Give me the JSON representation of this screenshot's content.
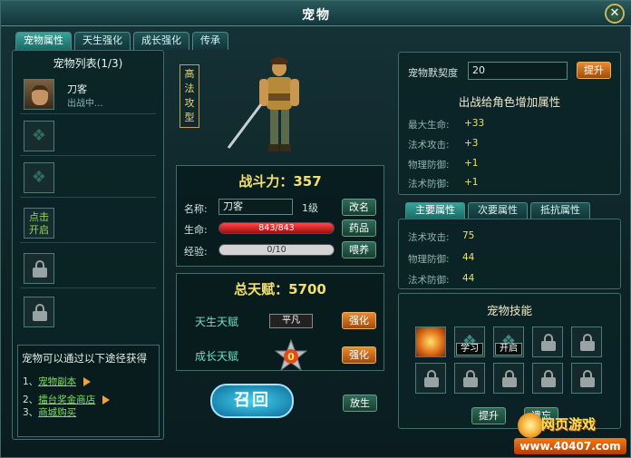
{
  "window": {
    "title": "宠物",
    "close_icon": "✕"
  },
  "tabs": [
    "宠物属性",
    "天生强化",
    "成长强化",
    "传承"
  ],
  "pet_list": {
    "title": "宠物列表(1/3)",
    "pets": [
      {
        "name": "刀客",
        "status": "出战中..."
      }
    ],
    "unlock_label": "点击\n开启",
    "unlock_line1": "点击",
    "unlock_line2": "开启"
  },
  "obtain": {
    "title": "宠物可以通过以下途径获得",
    "items": [
      {
        "index": "1、",
        "link": "宠物副本"
      },
      {
        "index": "2、",
        "link": "擂台奖金商店"
      },
      {
        "index": "3、",
        "link": "商城购买"
      }
    ]
  },
  "pet": {
    "type_badge": [
      "高",
      "法",
      "攻",
      "型"
    ],
    "power_label": "战斗力：357",
    "name_label": "名称:",
    "name_value": "刀客",
    "level": "1级",
    "hp_label": "生命:",
    "hp_text": "843/843",
    "hp_fraction": 1.0,
    "exp_label": "经验:",
    "exp_text": "0/10",
    "exp_fraction": 0.0,
    "rename_button": "改名",
    "potion_button": "药品",
    "feed_button": "喂养"
  },
  "talent": {
    "total_label": "总天赋：5700",
    "innate_label": "天生天赋",
    "innate_grade": "平凡",
    "growth_label": "成长天赋",
    "growth_star_value": "0",
    "enhance_button": "强化"
  },
  "actions": {
    "summon": "召回",
    "release": "放生"
  },
  "intimacy": {
    "label": "宠物默契度",
    "value": "20",
    "upgrade_button": "提升"
  },
  "bonus": {
    "title": "出战给角色增加属性",
    "rows": [
      {
        "label": "最大生命:",
        "value": "+33"
      },
      {
        "label": "法术攻击:",
        "value": "+3"
      },
      {
        "label": "物理防御:",
        "value": "+1"
      },
      {
        "label": "法术防御:",
        "value": "+1"
      }
    ]
  },
  "attr_tabs": [
    "主要属性",
    "次要属性",
    "抵抗属性"
  ],
  "main_attrs": [
    {
      "label": "法术攻击:",
      "value": "75"
    },
    {
      "label": "物理防御:",
      "value": "44"
    },
    {
      "label": "法术防御:",
      "value": "44"
    }
  ],
  "skills": {
    "title": "宠物技能",
    "learn_label": "学习",
    "open_label": "开启",
    "upgrade_button": "提升",
    "forget_button": "遗忘"
  },
  "watermark": {
    "top": "网页游戏",
    "url": "www.40407.com"
  },
  "colors": {
    "gold": "#f1e06c",
    "green_link": "#7de05a",
    "hp_red": "#d21b1b"
  }
}
